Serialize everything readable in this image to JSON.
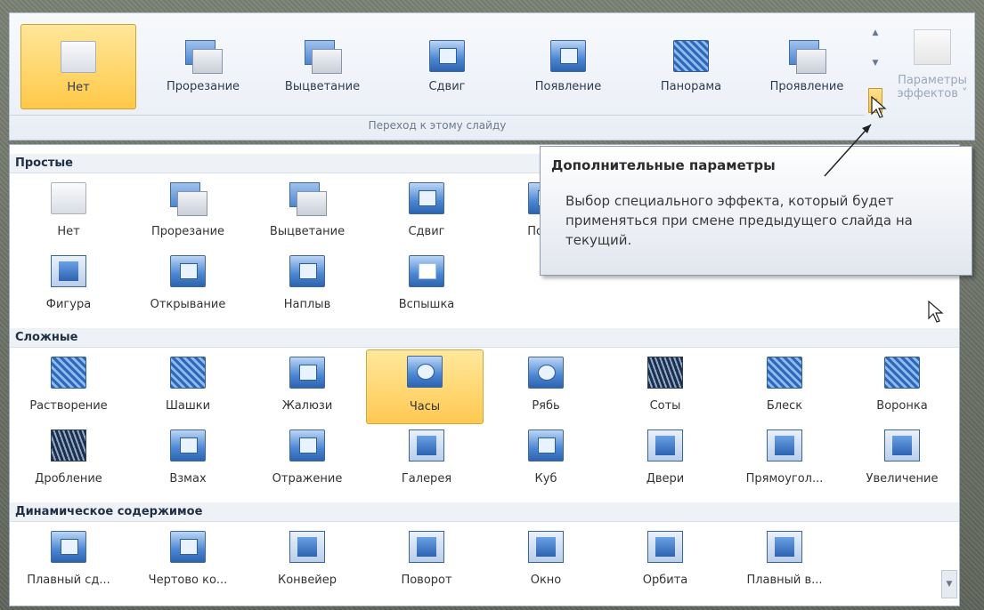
{
  "ribbon": {
    "items": [
      {
        "label": "Нет",
        "selected": true
      },
      {
        "label": "Прорезание"
      },
      {
        "label": "Выцветание"
      },
      {
        "label": "Сдвиг"
      },
      {
        "label": "Появление"
      },
      {
        "label": "Панорама"
      },
      {
        "label": "Проявление"
      }
    ],
    "group_label": "Переход к этому слайду",
    "effect_options_label_1": "Параметры",
    "effect_options_label_2": "эффектов ˅"
  },
  "tooltip": {
    "title": "Дополнительные параметры",
    "description": "Выбор специального эффекта, который будет применяться при смене предыдущего слайда на текущий."
  },
  "gallery": {
    "categories": [
      {
        "title": "Простые",
        "items": [
          "Нет",
          "Прорезание",
          "Выцветание",
          "Сдвиг",
          "Появл",
          "Фигура",
          "Открывание",
          "Наплыв",
          "Вспышка"
        ]
      },
      {
        "title": "Сложные",
        "items": [
          "Растворение",
          "Шашки",
          "Жалюзи",
          "Часы",
          "Рябь",
          "Соты",
          "Блеск",
          "Воронка",
          "Дробление",
          "Взмах",
          "Отражение",
          "Галерея",
          "Куб",
          "Двери",
          "Прямоугол...",
          "Увеличение"
        ]
      },
      {
        "title": "Динамическое содержимое",
        "items": [
          "Плавный сд...",
          "Чертово ко...",
          "Конвейер",
          "Поворот",
          "Окно",
          "Орбита",
          "Плавный в..."
        ]
      }
    ],
    "selected_item": "Часы"
  },
  "colors": {
    "selected_bg": "#ffc848",
    "accent_blue": "#4a86d3"
  }
}
